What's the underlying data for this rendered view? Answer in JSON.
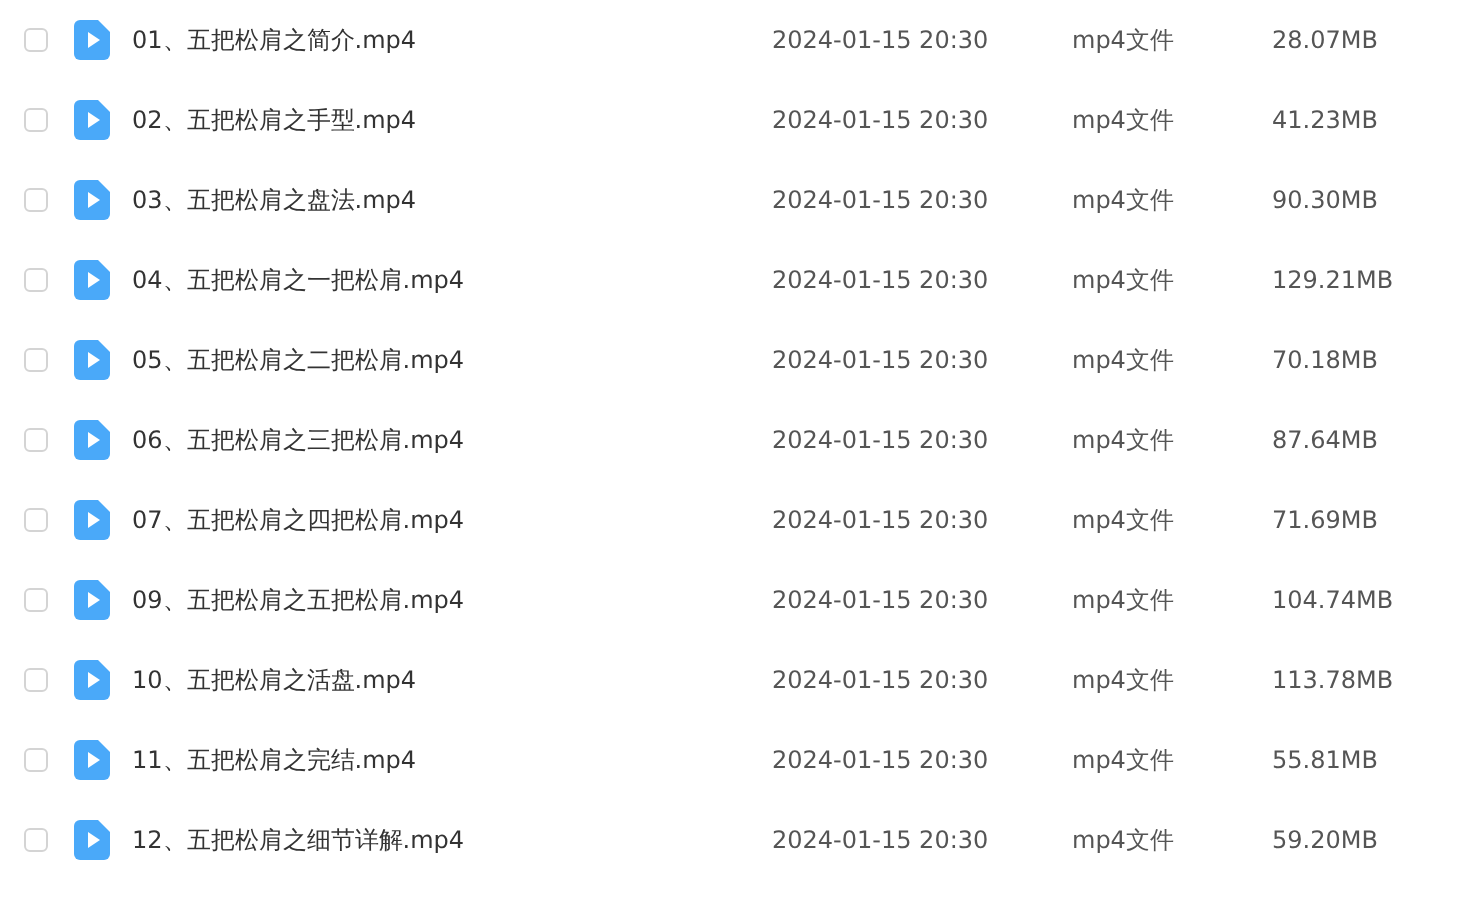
{
  "files": [
    {
      "name": "01、五把松肩之简介.mp4",
      "modified": "2024-01-15 20:30",
      "type": "mp4文件",
      "size": "28.07MB",
      "selected": false
    },
    {
      "name": "02、五把松肩之手型.mp4",
      "modified": "2024-01-15 20:30",
      "type": "mp4文件",
      "size": "41.23MB",
      "selected": false
    },
    {
      "name": "03、五把松肩之盘法.mp4",
      "modified": "2024-01-15 20:30",
      "type": "mp4文件",
      "size": "90.30MB",
      "selected": false
    },
    {
      "name": "04、五把松肩之一把松肩.mp4",
      "modified": "2024-01-15 20:30",
      "type": "mp4文件",
      "size": "129.21MB",
      "selected": false
    },
    {
      "name": "05、五把松肩之二把松肩.mp4",
      "modified": "2024-01-15 20:30",
      "type": "mp4文件",
      "size": "70.18MB",
      "selected": false
    },
    {
      "name": "06、五把松肩之三把松肩.mp4",
      "modified": "2024-01-15 20:30",
      "type": "mp4文件",
      "size": "87.64MB",
      "selected": false
    },
    {
      "name": "07、五把松肩之四把松肩.mp4",
      "modified": "2024-01-15 20:30",
      "type": "mp4文件",
      "size": "71.69MB",
      "selected": false
    },
    {
      "name": "09、五把松肩之五把松肩.mp4",
      "modified": "2024-01-15 20:30",
      "type": "mp4文件",
      "size": "104.74MB",
      "selected": false
    },
    {
      "name": "10、五把松肩之活盘.mp4",
      "modified": "2024-01-15 20:30",
      "type": "mp4文件",
      "size": "113.78MB",
      "selected": false
    },
    {
      "name": "11、五把松肩之完结.mp4",
      "modified": "2024-01-15 20:30",
      "type": "mp4文件",
      "size": "55.81MB",
      "selected": false
    },
    {
      "name": "12、五把松肩之细节详解.mp4",
      "modified": "2024-01-15 20:30",
      "type": "mp4文件",
      "size": "59.20MB",
      "selected": false
    }
  ]
}
